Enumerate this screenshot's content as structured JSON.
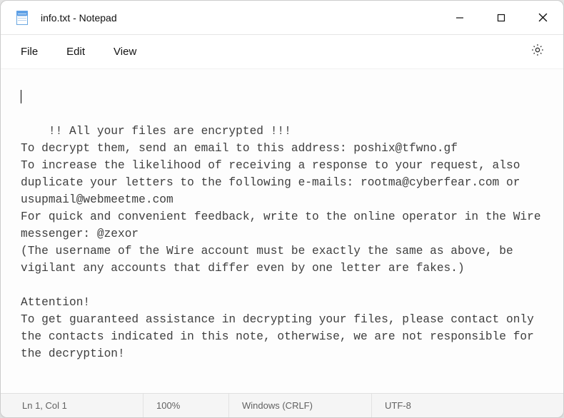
{
  "window": {
    "title": "info.txt - Notepad"
  },
  "menu": {
    "file": "File",
    "edit": "Edit",
    "view": "View"
  },
  "content": {
    "text": "!! All your files are encrypted !!!\nTo decrypt them, send an email to this address: poshix@tfwno.gf\nTo increase the likelihood of receiving a response to your request, also duplicate your letters to the following e-mails: rootma@cyberfear.com or usupmail@webmeetme.com\nFor quick and convenient feedback, write to the online operator in the Wire messenger: @zexor\n(The username of the Wire account must be exactly the same as above, be vigilant any accounts that differ even by one letter are fakes.)\n\nAttention!\nTo get guaranteed assistance in decrypting your files, please contact only the contacts indicated in this note, otherwise, we are not responsible for the decryption!"
  },
  "status": {
    "position": "Ln 1, Col 1",
    "zoom": "100%",
    "eol": "Windows (CRLF)",
    "encoding": "UTF-8"
  }
}
